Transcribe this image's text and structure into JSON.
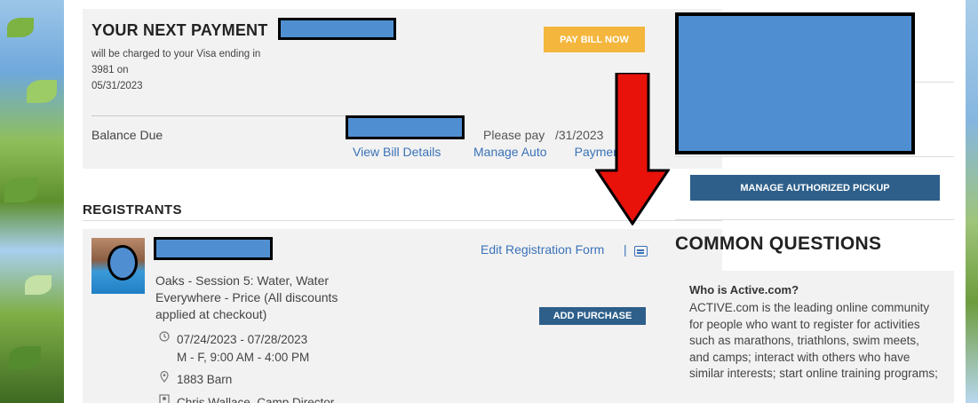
{
  "payment": {
    "title": "YOUR NEXT PAYMENT",
    "description_line1": "will be charged to your Visa ending in",
    "description_line2": "3981 on",
    "description_line3": "05/31/2023",
    "pay_button": "PAY BILL NOW",
    "balance_label": "Balance Due",
    "please_pay": "Please pay   /31/2023",
    "view_bill_link": "View Bill Details",
    "manage_auto_link": "Manage Auto        Payments"
  },
  "registrants": {
    "heading": "REGISTRANTS",
    "edit_link": "Edit Registration Form",
    "separator": "|",
    "session_text": "Oaks - Session 5: Water, Water Everywhere - Price (All discounts applied at checkout)",
    "add_purchase_button": "ADD PURCHASE",
    "dates": "07/24/2023 - 07/28/2023",
    "hours": "M - F, 9:00 AM - 4:00 PM",
    "location": "1883 Barn",
    "director": "Chris Wallace, Camp Director"
  },
  "sidebar": {
    "pickup_button": "MANAGE AUTHORIZED PICKUP",
    "common_questions_heading": "COMMON QUESTIONS",
    "faq_question": "Who is Active.com?",
    "faq_answer": "ACTIVE.com is the leading online community for people who want to register for activities such as marathons, triathlons, swim meets, and camps; interact with others who have similar interests; start online training programs;"
  },
  "icons": {
    "clock": "clock-icon",
    "location": "location-pin-icon",
    "person": "person-icon",
    "print": "print-icon"
  },
  "colors": {
    "pay_button": "#f4b63c",
    "primary_button": "#2d5f8a",
    "link": "#3a72b8",
    "redaction": "#4f8fd1",
    "annotation_arrow": "#e8120b"
  }
}
